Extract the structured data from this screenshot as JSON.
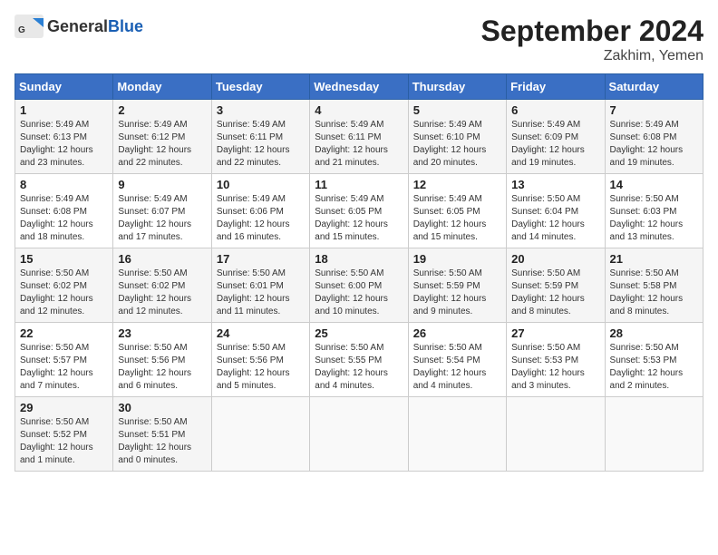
{
  "header": {
    "logo_general": "General",
    "logo_blue": "Blue",
    "month_title": "September 2024",
    "location": "Zakhim, Yemen"
  },
  "days_of_week": [
    "Sunday",
    "Monday",
    "Tuesday",
    "Wednesday",
    "Thursday",
    "Friday",
    "Saturday"
  ],
  "weeks": [
    [
      {
        "day": "1",
        "sunrise": "5:49 AM",
        "sunset": "6:13 PM",
        "daylight": "12 hours and 23 minutes."
      },
      {
        "day": "2",
        "sunrise": "5:49 AM",
        "sunset": "6:12 PM",
        "daylight": "12 hours and 22 minutes."
      },
      {
        "day": "3",
        "sunrise": "5:49 AM",
        "sunset": "6:11 PM",
        "daylight": "12 hours and 22 minutes."
      },
      {
        "day": "4",
        "sunrise": "5:49 AM",
        "sunset": "6:11 PM",
        "daylight": "12 hours and 21 minutes."
      },
      {
        "day": "5",
        "sunrise": "5:49 AM",
        "sunset": "6:10 PM",
        "daylight": "12 hours and 20 minutes."
      },
      {
        "day": "6",
        "sunrise": "5:49 AM",
        "sunset": "6:09 PM",
        "daylight": "12 hours and 19 minutes."
      },
      {
        "day": "7",
        "sunrise": "5:49 AM",
        "sunset": "6:08 PM",
        "daylight": "12 hours and 19 minutes."
      }
    ],
    [
      {
        "day": "8",
        "sunrise": "5:49 AM",
        "sunset": "6:08 PM",
        "daylight": "12 hours and 18 minutes."
      },
      {
        "day": "9",
        "sunrise": "5:49 AM",
        "sunset": "6:07 PM",
        "daylight": "12 hours and 17 minutes."
      },
      {
        "day": "10",
        "sunrise": "5:49 AM",
        "sunset": "6:06 PM",
        "daylight": "12 hours and 16 minutes."
      },
      {
        "day": "11",
        "sunrise": "5:49 AM",
        "sunset": "6:05 PM",
        "daylight": "12 hours and 15 minutes."
      },
      {
        "day": "12",
        "sunrise": "5:49 AM",
        "sunset": "6:05 PM",
        "daylight": "12 hours and 15 minutes."
      },
      {
        "day": "13",
        "sunrise": "5:50 AM",
        "sunset": "6:04 PM",
        "daylight": "12 hours and 14 minutes."
      },
      {
        "day": "14",
        "sunrise": "5:50 AM",
        "sunset": "6:03 PM",
        "daylight": "12 hours and 13 minutes."
      }
    ],
    [
      {
        "day": "15",
        "sunrise": "5:50 AM",
        "sunset": "6:02 PM",
        "daylight": "12 hours and 12 minutes."
      },
      {
        "day": "16",
        "sunrise": "5:50 AM",
        "sunset": "6:02 PM",
        "daylight": "12 hours and 12 minutes."
      },
      {
        "day": "17",
        "sunrise": "5:50 AM",
        "sunset": "6:01 PM",
        "daylight": "12 hours and 11 minutes."
      },
      {
        "day": "18",
        "sunrise": "5:50 AM",
        "sunset": "6:00 PM",
        "daylight": "12 hours and 10 minutes."
      },
      {
        "day": "19",
        "sunrise": "5:50 AM",
        "sunset": "5:59 PM",
        "daylight": "12 hours and 9 minutes."
      },
      {
        "day": "20",
        "sunrise": "5:50 AM",
        "sunset": "5:59 PM",
        "daylight": "12 hours and 8 minutes."
      },
      {
        "day": "21",
        "sunrise": "5:50 AM",
        "sunset": "5:58 PM",
        "daylight": "12 hours and 8 minutes."
      }
    ],
    [
      {
        "day": "22",
        "sunrise": "5:50 AM",
        "sunset": "5:57 PM",
        "daylight": "12 hours and 7 minutes."
      },
      {
        "day": "23",
        "sunrise": "5:50 AM",
        "sunset": "5:56 PM",
        "daylight": "12 hours and 6 minutes."
      },
      {
        "day": "24",
        "sunrise": "5:50 AM",
        "sunset": "5:56 PM",
        "daylight": "12 hours and 5 minutes."
      },
      {
        "day": "25",
        "sunrise": "5:50 AM",
        "sunset": "5:55 PM",
        "daylight": "12 hours and 4 minutes."
      },
      {
        "day": "26",
        "sunrise": "5:50 AM",
        "sunset": "5:54 PM",
        "daylight": "12 hours and 4 minutes."
      },
      {
        "day": "27",
        "sunrise": "5:50 AM",
        "sunset": "5:53 PM",
        "daylight": "12 hours and 3 minutes."
      },
      {
        "day": "28",
        "sunrise": "5:50 AM",
        "sunset": "5:53 PM",
        "daylight": "12 hours and 2 minutes."
      }
    ],
    [
      {
        "day": "29",
        "sunrise": "5:50 AM",
        "sunset": "5:52 PM",
        "daylight": "12 hours and 1 minute."
      },
      {
        "day": "30",
        "sunrise": "5:50 AM",
        "sunset": "5:51 PM",
        "daylight": "12 hours and 0 minutes."
      },
      null,
      null,
      null,
      null,
      null
    ]
  ]
}
